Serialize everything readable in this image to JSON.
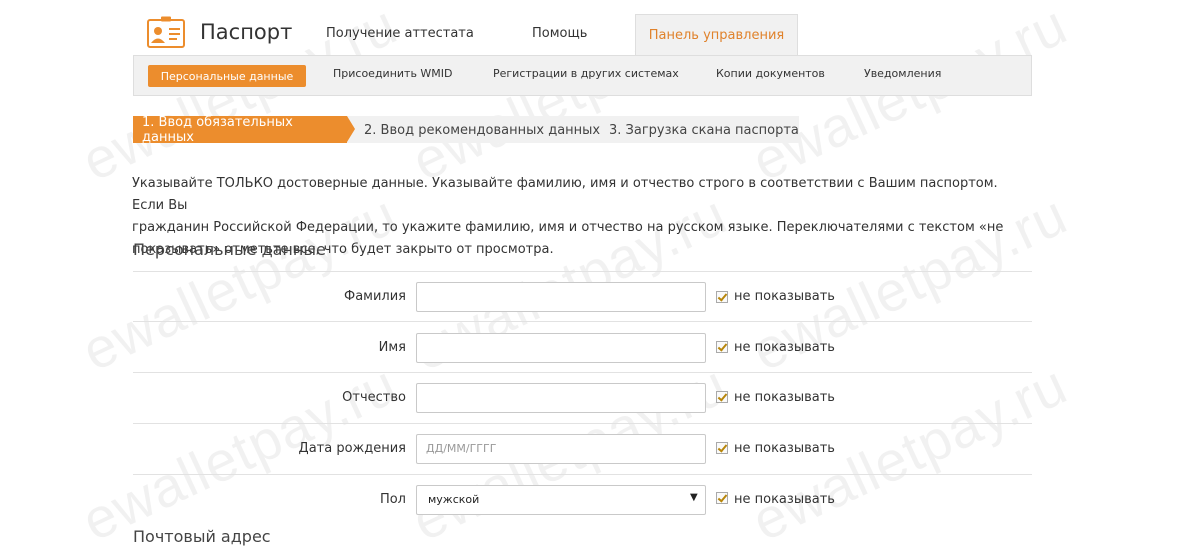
{
  "header": {
    "title": "Паспорт",
    "logo_icon": "passport-card-icon",
    "tabs": [
      {
        "label": "Получение аттестата"
      },
      {
        "label": "Помощь"
      },
      {
        "label": "Панель управления",
        "active": true
      }
    ]
  },
  "subnav": {
    "items": [
      {
        "label": "Персональные данные",
        "active": true
      },
      {
        "label": "Присоединить WMID"
      },
      {
        "label": "Регистрации в других системах"
      },
      {
        "label": "Копии документов"
      },
      {
        "label": "Уведомления"
      }
    ]
  },
  "steps": [
    {
      "label": "1. Ввод обязательных данных",
      "active": true
    },
    {
      "label": "2. Ввод рекомендованных данных"
    },
    {
      "label": "3. Загрузка скана паспорта"
    }
  ],
  "intro": {
    "line1": "Указывайте ТОЛЬКО достоверные данные. Указывайте фамилию, имя и отчество строго в соответствии с Вашим паспортом. Если Вы",
    "line2": "гражданин Российской Федерации, то укажите фамилию, имя и отчество на русском языке. Переключателями с текстом «не",
    "line3": "показывать» отметьте все, что будет закрыто от просмотра."
  },
  "personal": {
    "title": "Персональные данные",
    "fields": [
      {
        "label": "Фамилия",
        "value": "",
        "hide_label": "не показывать",
        "hide_checked": true
      },
      {
        "label": "Имя",
        "value": "",
        "hide_label": "не показывать",
        "hide_checked": true
      },
      {
        "label": "Отчество",
        "value": "",
        "hide_label": "не показывать",
        "hide_checked": true
      },
      {
        "label": "Дата рождения",
        "placeholder": "ДД/ММ/ГГГГ",
        "hide_label": "не показывать",
        "hide_checked": true
      },
      {
        "label": "Пол",
        "selected": "мужской",
        "hide_label": "не показывать",
        "hide_checked": true
      }
    ]
  },
  "postal": {
    "title": "Почтовый адрес"
  },
  "watermark": "ewalletpay.ru",
  "colors": {
    "accent": "#ec8d2d",
    "accent_text": "#e0822b",
    "tab_bg": "#f1f1f1"
  }
}
